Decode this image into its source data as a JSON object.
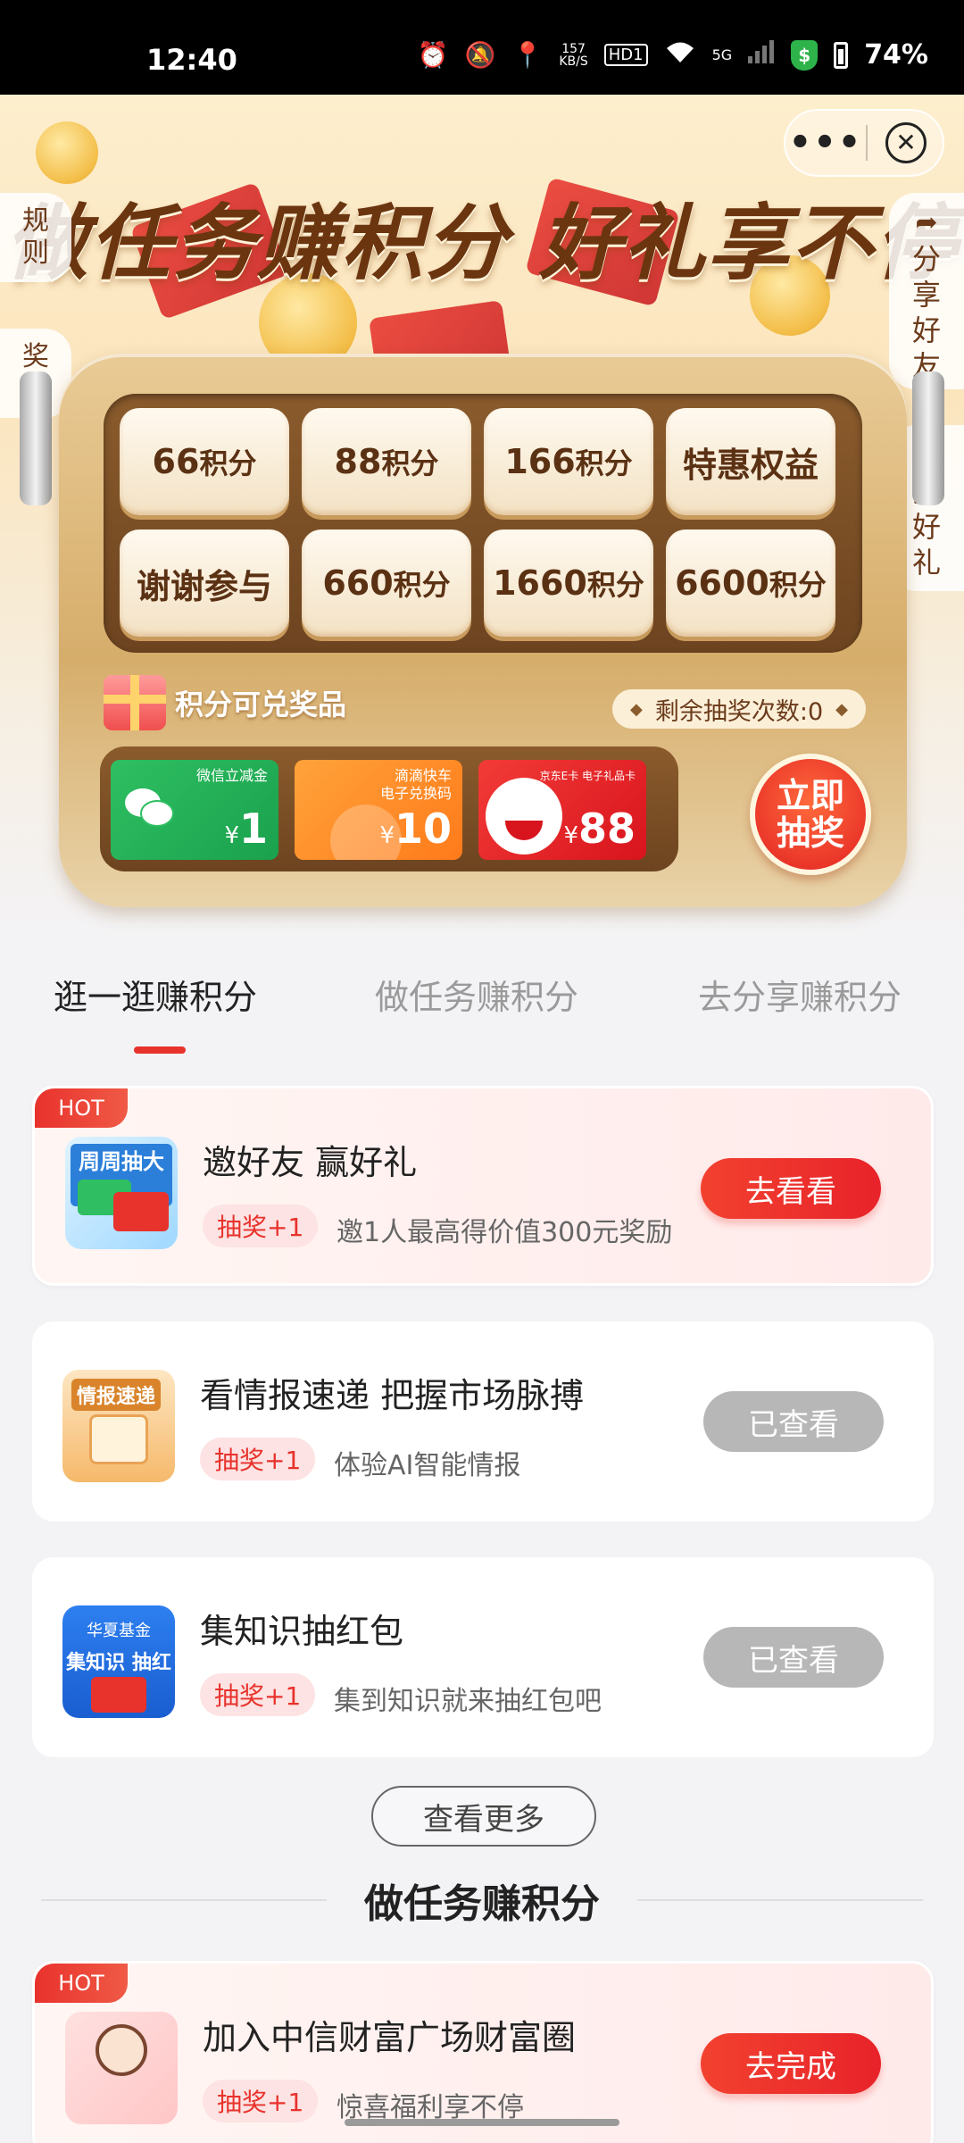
{
  "status_bar": {
    "time": "12:40",
    "net_speed_top": "157",
    "net_speed_bottom": "KB/S",
    "hd": "HD1",
    "signal": "5G",
    "battery": "74%"
  },
  "capsule": {
    "more": "•••",
    "close": "✕"
  },
  "hero": {
    "title": "做任务赚积分 好礼享不停",
    "side_left": [
      "规则",
      "奖品"
    ],
    "side_right": [
      "分享好友",
      "兑换好礼"
    ]
  },
  "lottery": {
    "cells": [
      {
        "num": "66",
        "unit": "积分"
      },
      {
        "num": "88",
        "unit": "积分"
      },
      {
        "num": "166",
        "unit": "积分"
      },
      {
        "num": "特惠权益",
        "unit": ""
      },
      {
        "num": "谢谢参与",
        "unit": ""
      },
      {
        "num": "660",
        "unit": "积分"
      },
      {
        "num": "1660",
        "unit": "积分"
      },
      {
        "num": "6600",
        "unit": "积分"
      }
    ],
    "redeem_label": "积分可兑奖品",
    "remaining": "剩余抽奖次数:0",
    "prizes": [
      {
        "top": "微信立减金",
        "currency": "¥",
        "value": "1"
      },
      {
        "top": "滴滴快车\n电子兑换码",
        "currency": "¥",
        "value": "10"
      },
      {
        "top": "京东E卡 电子礼品卡",
        "currency": "¥",
        "value": "88"
      }
    ],
    "draw_button": "立即\n抽奖"
  },
  "tabs": [
    "逛一逛赚积分",
    "做任务赚积分",
    "去分享赚积分"
  ],
  "tasks": [
    {
      "hot": "HOT",
      "img_text": "周周抽大奖",
      "title": "邀好友 赢好礼",
      "tag": "抽奖+1",
      "desc": "邀1人最高得价值300元奖励",
      "button": "去看看"
    },
    {
      "img_text": "情报速递",
      "title": "看情报速递 把握市场脉搏",
      "tag": "抽奖+1",
      "desc": "体验AI智能情报",
      "button": "已查看"
    },
    {
      "img_text_top": "华夏基金",
      "img_text": "集知识 抽红包",
      "title": "集知识抽红包",
      "tag": "抽奖+1",
      "desc": "集到知识就来抽红包吧",
      "button": "已查看"
    }
  ],
  "more_button": "查看更多",
  "section_title": "做任务赚积分",
  "task2": {
    "hot": "HOT",
    "title": "加入中信财富广场财富圈",
    "tag": "抽奖+1",
    "desc": "惊喜福利享不停",
    "button": "去完成"
  }
}
